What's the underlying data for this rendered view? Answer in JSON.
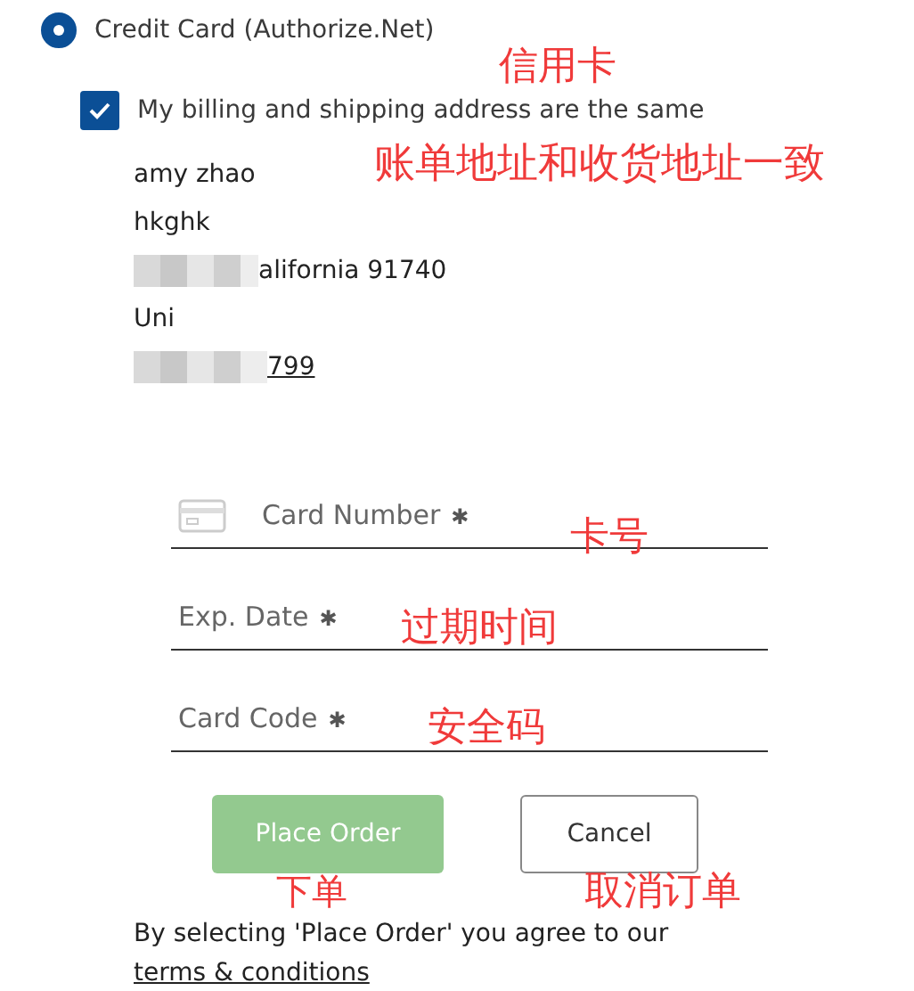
{
  "payment_method": {
    "label": "Credit Card (Authorize.Net)",
    "selected": true
  },
  "same_address": {
    "label": "My billing and shipping address are the same",
    "checked": true
  },
  "address_lines": [
    {
      "text": "amy zhao",
      "underlined": false
    },
    {
      "text": "hkghk",
      "underlined": false
    },
    {
      "text": "alifornia 91740",
      "underlined": false
    },
    {
      "text": "Uni",
      "underlined": false
    },
    {
      "text": "799",
      "underlined": true
    }
  ],
  "fields": [
    {
      "placeholder": "Card Number",
      "required_mark": "✱",
      "icon": true
    },
    {
      "placeholder": "Exp. Date",
      "required_mark": "✱",
      "icon": false
    },
    {
      "placeholder": "Card Code",
      "required_mark": "✱",
      "icon": false
    }
  ],
  "buttons": [
    {
      "label": "Place Order",
      "kind": "primary",
      "disabled": true
    },
    {
      "label": "Cancel",
      "kind": "secondary",
      "disabled": false
    }
  ],
  "terms": {
    "text": "By selecting 'Place Order' you agree to our",
    "link": "terms & conditions"
  },
  "annotations": [
    "信用卡",
    "账单地址和收货地址一致",
    "卡号",
    "过期时间",
    "安全码",
    "下单",
    "取消订单"
  ]
}
